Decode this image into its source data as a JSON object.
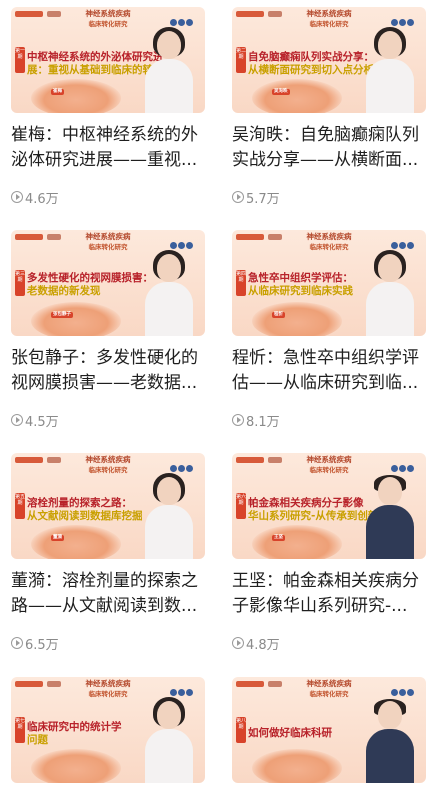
{
  "colors": {
    "title": "#1f1f1f",
    "meta": "#8a8a8a",
    "accent_red": "#b8222a",
    "accent_gold": "#c9a000"
  },
  "thumb_series": {
    "line1": "神经系统疾病",
    "line2": "临床转化研究"
  },
  "cards": [
    {
      "title": "崔梅：中枢神经系统的外泌体研究进展——重视...",
      "views": "4.6万",
      "thumb": {
        "badge": "第一期",
        "headline_l1": "中枢神经系统的外泌体研究进",
        "headline_l2": "展：重视从基础到临床的转化",
        "speaker": "崔梅",
        "portrait": "female-glasses"
      }
    },
    {
      "title": "吴洵昳：自免脑癫痫队列实战分享——从横断面...",
      "views": "5.7万",
      "thumb": {
        "badge": "第二期",
        "headline_l1": "自免脑癫痫队列实战分享：",
        "headline_l2": "从横断面研究到切入点分析",
        "speaker": "吴洵昳",
        "portrait": "female"
      }
    },
    {
      "title": "张包静子：多发性硬化的视网膜损害——老数据...",
      "views": "4.5万",
      "thumb": {
        "badge": "第三期",
        "headline_l1": "多发性硬化的视网膜损害：",
        "headline_l2": "老数据的新发现",
        "speaker": "张包静子",
        "portrait": "female"
      }
    },
    {
      "title": "程忻：急性卒中组织学评估——从临床研究到临...",
      "views": "8.1万",
      "thumb": {
        "badge": "第四期",
        "headline_l1": "急性卒中组织学评估：",
        "headline_l2": "从临床研究到临床实践",
        "speaker": "程忻",
        "portrait": "female"
      }
    },
    {
      "title": "董漪：溶栓剂量的探索之路——从文献阅读到数...",
      "views": "6.5万",
      "thumb": {
        "badge": "第五期",
        "headline_l1": "溶栓剂量的探索之路：",
        "headline_l2": "从文献阅读到数据库挖掘",
        "speaker": "董漪",
        "portrait": "female"
      }
    },
    {
      "title": "王坚：帕金森相关疾病分子影像华山系列研究-...",
      "views": "4.8万",
      "thumb": {
        "badge": "第六期",
        "headline_l1": "帕金森相关疾病分子影像",
        "headline_l2": "华山系列研究-从传承到创新",
        "speaker": "王坚",
        "portrait": "male-glasses"
      }
    },
    {
      "title": "",
      "views": "",
      "thumb": {
        "badge": "第七期",
        "headline_l1": "临床研究中的统计学",
        "headline_l2": "问题",
        "speaker": "",
        "portrait": "female"
      }
    },
    {
      "title": "",
      "views": "",
      "thumb": {
        "badge": "第八期",
        "headline_l1": "如何做好临床科研",
        "headline_l2": "",
        "speaker": "",
        "portrait": "male"
      }
    }
  ]
}
